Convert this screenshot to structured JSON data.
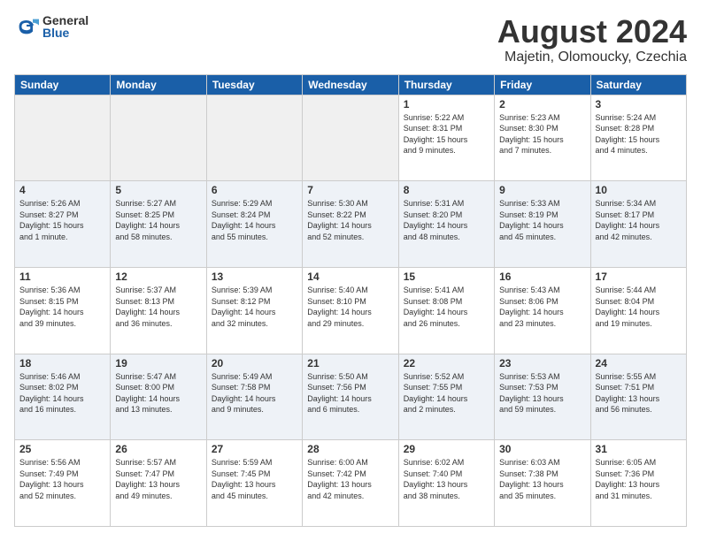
{
  "logo": {
    "general": "General",
    "blue": "Blue"
  },
  "title": "August 2024",
  "subtitle": "Majetin, Olomoucky, Czechia",
  "days_of_week": [
    "Sunday",
    "Monday",
    "Tuesday",
    "Wednesday",
    "Thursday",
    "Friday",
    "Saturday"
  ],
  "weeks": [
    [
      {
        "day": "",
        "info": ""
      },
      {
        "day": "",
        "info": ""
      },
      {
        "day": "",
        "info": ""
      },
      {
        "day": "",
        "info": ""
      },
      {
        "day": "1",
        "info": "Sunrise: 5:22 AM\nSunset: 8:31 PM\nDaylight: 15 hours\nand 9 minutes."
      },
      {
        "day": "2",
        "info": "Sunrise: 5:23 AM\nSunset: 8:30 PM\nDaylight: 15 hours\nand 7 minutes."
      },
      {
        "day": "3",
        "info": "Sunrise: 5:24 AM\nSunset: 8:28 PM\nDaylight: 15 hours\nand 4 minutes."
      }
    ],
    [
      {
        "day": "4",
        "info": "Sunrise: 5:26 AM\nSunset: 8:27 PM\nDaylight: 15 hours\nand 1 minute."
      },
      {
        "day": "5",
        "info": "Sunrise: 5:27 AM\nSunset: 8:25 PM\nDaylight: 14 hours\nand 58 minutes."
      },
      {
        "day": "6",
        "info": "Sunrise: 5:29 AM\nSunset: 8:24 PM\nDaylight: 14 hours\nand 55 minutes."
      },
      {
        "day": "7",
        "info": "Sunrise: 5:30 AM\nSunset: 8:22 PM\nDaylight: 14 hours\nand 52 minutes."
      },
      {
        "day": "8",
        "info": "Sunrise: 5:31 AM\nSunset: 8:20 PM\nDaylight: 14 hours\nand 48 minutes."
      },
      {
        "day": "9",
        "info": "Sunrise: 5:33 AM\nSunset: 8:19 PM\nDaylight: 14 hours\nand 45 minutes."
      },
      {
        "day": "10",
        "info": "Sunrise: 5:34 AM\nSunset: 8:17 PM\nDaylight: 14 hours\nand 42 minutes."
      }
    ],
    [
      {
        "day": "11",
        "info": "Sunrise: 5:36 AM\nSunset: 8:15 PM\nDaylight: 14 hours\nand 39 minutes."
      },
      {
        "day": "12",
        "info": "Sunrise: 5:37 AM\nSunset: 8:13 PM\nDaylight: 14 hours\nand 36 minutes."
      },
      {
        "day": "13",
        "info": "Sunrise: 5:39 AM\nSunset: 8:12 PM\nDaylight: 14 hours\nand 32 minutes."
      },
      {
        "day": "14",
        "info": "Sunrise: 5:40 AM\nSunset: 8:10 PM\nDaylight: 14 hours\nand 29 minutes."
      },
      {
        "day": "15",
        "info": "Sunrise: 5:41 AM\nSunset: 8:08 PM\nDaylight: 14 hours\nand 26 minutes."
      },
      {
        "day": "16",
        "info": "Sunrise: 5:43 AM\nSunset: 8:06 PM\nDaylight: 14 hours\nand 23 minutes."
      },
      {
        "day": "17",
        "info": "Sunrise: 5:44 AM\nSunset: 8:04 PM\nDaylight: 14 hours\nand 19 minutes."
      }
    ],
    [
      {
        "day": "18",
        "info": "Sunrise: 5:46 AM\nSunset: 8:02 PM\nDaylight: 14 hours\nand 16 minutes."
      },
      {
        "day": "19",
        "info": "Sunrise: 5:47 AM\nSunset: 8:00 PM\nDaylight: 14 hours\nand 13 minutes."
      },
      {
        "day": "20",
        "info": "Sunrise: 5:49 AM\nSunset: 7:58 PM\nDaylight: 14 hours\nand 9 minutes."
      },
      {
        "day": "21",
        "info": "Sunrise: 5:50 AM\nSunset: 7:56 PM\nDaylight: 14 hours\nand 6 minutes."
      },
      {
        "day": "22",
        "info": "Sunrise: 5:52 AM\nSunset: 7:55 PM\nDaylight: 14 hours\nand 2 minutes."
      },
      {
        "day": "23",
        "info": "Sunrise: 5:53 AM\nSunset: 7:53 PM\nDaylight: 13 hours\nand 59 minutes."
      },
      {
        "day": "24",
        "info": "Sunrise: 5:55 AM\nSunset: 7:51 PM\nDaylight: 13 hours\nand 56 minutes."
      }
    ],
    [
      {
        "day": "25",
        "info": "Sunrise: 5:56 AM\nSunset: 7:49 PM\nDaylight: 13 hours\nand 52 minutes."
      },
      {
        "day": "26",
        "info": "Sunrise: 5:57 AM\nSunset: 7:47 PM\nDaylight: 13 hours\nand 49 minutes."
      },
      {
        "day": "27",
        "info": "Sunrise: 5:59 AM\nSunset: 7:45 PM\nDaylight: 13 hours\nand 45 minutes."
      },
      {
        "day": "28",
        "info": "Sunrise: 6:00 AM\nSunset: 7:42 PM\nDaylight: 13 hours\nand 42 minutes."
      },
      {
        "day": "29",
        "info": "Sunrise: 6:02 AM\nSunset: 7:40 PM\nDaylight: 13 hours\nand 38 minutes."
      },
      {
        "day": "30",
        "info": "Sunrise: 6:03 AM\nSunset: 7:38 PM\nDaylight: 13 hours\nand 35 minutes."
      },
      {
        "day": "31",
        "info": "Sunrise: 6:05 AM\nSunset: 7:36 PM\nDaylight: 13 hours\nand 31 minutes."
      }
    ]
  ]
}
